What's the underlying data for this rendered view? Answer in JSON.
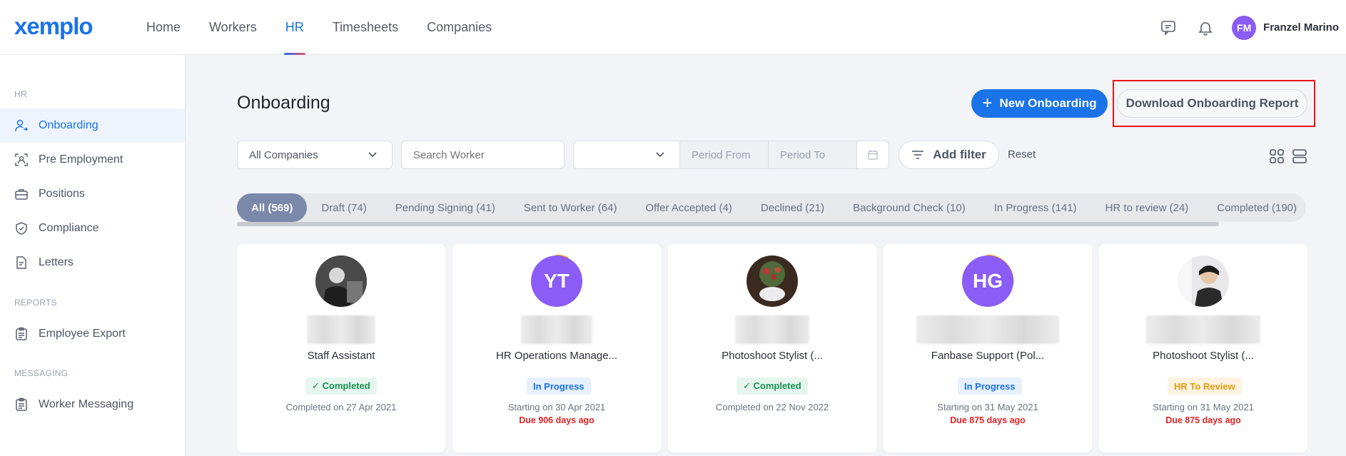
{
  "brand": {
    "logo": "xemplo",
    "accent": "#1a73e8"
  },
  "nav": {
    "items": [
      {
        "label": "Home"
      },
      {
        "label": "Workers"
      },
      {
        "label": "HR"
      },
      {
        "label": "Timesheets"
      },
      {
        "label": "Companies"
      }
    ],
    "active": "HR"
  },
  "user": {
    "initials": "FM",
    "name": "Franzel Marino"
  },
  "sidebar": {
    "sections": [
      {
        "title": "HR",
        "items": [
          {
            "label": "Onboarding",
            "icon": "user-arrow-icon",
            "active": true
          },
          {
            "label": "Pre Employment",
            "icon": "id-scan-icon"
          },
          {
            "label": "Positions",
            "icon": "briefcase-icon"
          },
          {
            "label": "Compliance",
            "icon": "shield-check-icon"
          },
          {
            "label": "Letters",
            "icon": "document-icon"
          }
        ]
      },
      {
        "title": "REPORTS",
        "items": [
          {
            "label": "Employee Export",
            "icon": "clipboard-icon"
          }
        ]
      },
      {
        "title": "MESSAGING",
        "items": [
          {
            "label": "Worker Messaging",
            "icon": "clipboard-icon"
          }
        ]
      }
    ]
  },
  "page": {
    "title": "Onboarding",
    "new_button": "New Onboarding",
    "report_button": "Download Onboarding Report"
  },
  "filters": {
    "company": "All Companies",
    "search_placeholder": "Search Worker",
    "period_select": "",
    "period_from": "Period From",
    "period_to": "Period To",
    "add_filter": "Add filter",
    "reset": "Reset"
  },
  "tabs": [
    {
      "label": "All (569)",
      "active": true
    },
    {
      "label": "Draft (74)"
    },
    {
      "label": "Pending Signing (41)"
    },
    {
      "label": "Sent to Worker (64)"
    },
    {
      "label": "Offer Accepted (4)"
    },
    {
      "label": "Declined (21)"
    },
    {
      "label": "Background Check (10)"
    },
    {
      "label": "In Progress (141)"
    },
    {
      "label": "HR to review (24)"
    },
    {
      "label": "Completed (190)"
    }
  ],
  "cards": [
    {
      "avatar": "photo",
      "title": "Staff Assistant",
      "status": "✓ Completed",
      "status_type": "completed",
      "date": "Completed on 27 Apr 2021",
      "due": ""
    },
    {
      "avatar": "YT",
      "avatar_color": "#8b5cf6",
      "title": "HR Operations Manage...",
      "status": "In Progress",
      "status_type": "progress",
      "date": "Starting on 30 Apr 2021",
      "due": "Due 906 days ago"
    },
    {
      "avatar": "photo",
      "title": "Photoshoot Stylist (...",
      "status": "✓ Completed",
      "status_type": "completed",
      "date": "Completed on 22 Nov 2022",
      "due": ""
    },
    {
      "avatar": "HG",
      "avatar_color": "#8b5cf6",
      "title": "Fanbase Support (Pol...",
      "status": "In Progress",
      "status_type": "progress",
      "date": "Starting on 31 May 2021",
      "due": "Due 875 days ago"
    },
    {
      "avatar": "photo",
      "title": "Photoshoot Stylist (...",
      "status": "HR To Review",
      "status_type": "review",
      "date": "Starting on 31 May 2021",
      "due": "Due 875 days ago"
    }
  ]
}
